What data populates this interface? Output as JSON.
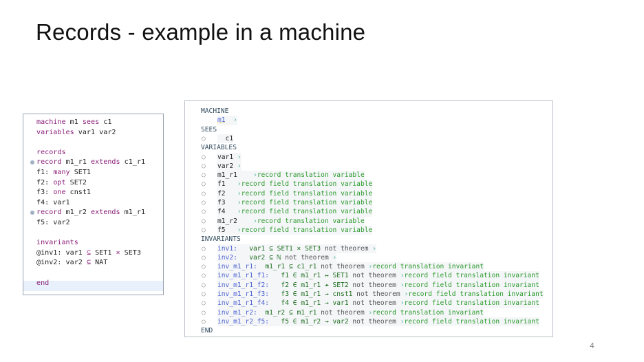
{
  "slide": {
    "title": "Records - example in a machine",
    "page_number": "4"
  },
  "editor": {
    "lines": [
      [
        {
          "t": "machine",
          "k": 1
        },
        {
          "t": " m1 "
        },
        {
          "t": "sees",
          "k": 1
        },
        {
          "t": " c1"
        }
      ],
      [
        {
          "t": "variables",
          "k": 1
        },
        {
          "t": " var1 var2"
        }
      ],
      [],
      [
        {
          "t": "records",
          "k": 1
        }
      ],
      [
        {
          "t": "record",
          "k": 1
        },
        {
          "t": " m1_r1 "
        },
        {
          "t": "extends",
          "k": 1
        },
        {
          "t": " c1_r1"
        }
      ],
      [
        {
          "t": "f1: "
        },
        {
          "t": "many",
          "k": 1
        },
        {
          "t": " SET1"
        }
      ],
      [
        {
          "t": "f2: "
        },
        {
          "t": "opt",
          "k": 1
        },
        {
          "t": " SET2"
        }
      ],
      [
        {
          "t": "f3: "
        },
        {
          "t": "one",
          "k": 1
        },
        {
          "t": " cnst1"
        }
      ],
      [
        {
          "t": "f4: var1"
        }
      ],
      [
        {
          "t": "record",
          "k": 1
        },
        {
          "t": " m1_r2 "
        },
        {
          "t": "extends",
          "k": 1
        },
        {
          "t": " m1_r1"
        }
      ],
      [
        {
          "t": "f5: var2"
        }
      ],
      [],
      [
        {
          "t": "invariants",
          "k": 1
        }
      ],
      [
        {
          "t": "@inv1: var1 "
        },
        {
          "t": "⊆",
          "k": 1
        },
        {
          "t": " SET1 "
        },
        {
          "t": "×",
          "k": 1
        },
        {
          "t": " SET3"
        }
      ],
      [
        {
          "t": "@inv2: var2 "
        },
        {
          "t": "⊆",
          "k": 1
        },
        {
          "t": " NAT"
        }
      ],
      [],
      [
        {
          "t": "end",
          "k": 1
        }
      ]
    ],
    "fold_lines": [
      4,
      9
    ],
    "highlight_line": 16
  },
  "translation": {
    "rows": [
      {
        "section": "MACHINE"
      },
      {
        "indent": 1,
        "segs": [
          {
            "t": "m1",
            "c": "label",
            "u": 1
          },
          {
            "t": "  ›",
            "c": "arrow"
          }
        ]
      },
      {
        "section": "SEES"
      },
      {
        "bullet": 1,
        "segs": [
          {
            "t": "  c1",
            "c": "dark"
          }
        ]
      },
      {
        "section": "VARIABLES"
      },
      {
        "bullet": 1,
        "segs": [
          {
            "t": "var1",
            "c": "dark"
          },
          {
            "t": " ›",
            "c": "arrow"
          }
        ]
      },
      {
        "bullet": 1,
        "segs": [
          {
            "t": "var2",
            "c": "dark"
          },
          {
            "t": " ›",
            "c": "arrow"
          }
        ]
      },
      {
        "bullet": 1,
        "segs": [
          {
            "t": "m1_r1    ",
            "c": "dark"
          },
          {
            "t": "›",
            "c": "arrow"
          },
          {
            "t": "record translation variable",
            "c": "cmt"
          }
        ]
      },
      {
        "bullet": 1,
        "segs": [
          {
            "t": "f1   ",
            "c": "dark"
          },
          {
            "t": "›",
            "c": "arrow"
          },
          {
            "t": "record field translation variable",
            "c": "cmt"
          }
        ]
      },
      {
        "bullet": 1,
        "segs": [
          {
            "t": "f2   ",
            "c": "dark"
          },
          {
            "t": "›",
            "c": "arrow"
          },
          {
            "t": "record field translation variable",
            "c": "cmt"
          }
        ]
      },
      {
        "bullet": 1,
        "segs": [
          {
            "t": "f3   ",
            "c": "dark"
          },
          {
            "t": "›",
            "c": "arrow"
          },
          {
            "t": "record field translation variable",
            "c": "cmt"
          }
        ]
      },
      {
        "bullet": 1,
        "segs": [
          {
            "t": "f4   ",
            "c": "dark"
          },
          {
            "t": "›",
            "c": "arrow"
          },
          {
            "t": "record field translation variable",
            "c": "cmt"
          }
        ]
      },
      {
        "bullet": 1,
        "segs": [
          {
            "t": "m1_r2    ",
            "c": "dark"
          },
          {
            "t": "›",
            "c": "arrow"
          },
          {
            "t": "record translation variable",
            "c": "cmt"
          }
        ]
      },
      {
        "bullet": 1,
        "segs": [
          {
            "t": "f5   ",
            "c": "dark"
          },
          {
            "t": "›",
            "c": "arrow"
          },
          {
            "t": "record field translation variable",
            "c": "cmt"
          }
        ]
      },
      {
        "section": "INVARIANTS"
      },
      {
        "bullet": 1,
        "segs": [
          {
            "t": "inv1:   ",
            "c": "label"
          },
          {
            "t": "var1 ⊆ SET1 × SET3",
            "c": "pred"
          },
          {
            "t": " not theorem ",
            "c": "gray"
          },
          {
            "t": "›",
            "c": "arrow"
          }
        ]
      },
      {
        "bullet": 1,
        "segs": [
          {
            "t": "inv2:   ",
            "c": "label"
          },
          {
            "t": "var2 ⊆ ℕ",
            "c": "pred"
          },
          {
            "t": " not theorem ",
            "c": "gray"
          },
          {
            "t": "›",
            "c": "arrow"
          }
        ]
      },
      {
        "bullet": 1,
        "segs": [
          {
            "t": "inv_m1_r1:  ",
            "c": "label"
          },
          {
            "t": "m1_r1 ⊆ c1_r1",
            "c": "pred"
          },
          {
            "t": " not theorem ",
            "c": "gray"
          },
          {
            "t": "›",
            "c": "arrow"
          },
          {
            "t": "record translation invariant",
            "c": "cmt"
          }
        ]
      },
      {
        "bullet": 1,
        "segs": [
          {
            "t": "inv_m1_r1_f1:   ",
            "c": "label"
          },
          {
            "t": "f1 ∈ m1_r1 ↔ SET1",
            "c": "pred"
          },
          {
            "t": " not theorem ",
            "c": "gray"
          },
          {
            "t": "›",
            "c": "arrow"
          },
          {
            "t": "record field translation invariant",
            "c": "cmt"
          }
        ]
      },
      {
        "bullet": 1,
        "segs": [
          {
            "t": "inv_m1_r1_f2:   ",
            "c": "label"
          },
          {
            "t": "f2 ∈ m1_r1 ⇸ SET2",
            "c": "pred"
          },
          {
            "t": " not theorem ",
            "c": "gray"
          },
          {
            "t": "›",
            "c": "arrow"
          },
          {
            "t": "record field translation invariant",
            "c": "cmt"
          }
        ]
      },
      {
        "bullet": 1,
        "segs": [
          {
            "t": "inv_m1_r1_f3:   ",
            "c": "label"
          },
          {
            "t": "f3 ∈ m1_r1 → cnst1",
            "c": "pred"
          },
          {
            "t": " not theorem ",
            "c": "gray"
          },
          {
            "t": "›",
            "c": "arrow"
          },
          {
            "t": "record field translation invariant",
            "c": "cmt"
          }
        ]
      },
      {
        "bullet": 1,
        "segs": [
          {
            "t": "inv_m1_r1_f4:   ",
            "c": "label"
          },
          {
            "t": "f4 ∈ m1_r1 → var1",
            "c": "pred"
          },
          {
            "t": " not theorem ",
            "c": "gray"
          },
          {
            "t": "›",
            "c": "arrow"
          },
          {
            "t": "record field translation invariant",
            "c": "cmt"
          }
        ]
      },
      {
        "bullet": 1,
        "segs": [
          {
            "t": "inv_m1_r2:  ",
            "c": "label"
          },
          {
            "t": "m1_r2 ⊆ m1_r1",
            "c": "pred"
          },
          {
            "t": " not theorem ",
            "c": "gray"
          },
          {
            "t": "›",
            "c": "arrow"
          },
          {
            "t": "record translation invariant",
            "c": "cmt"
          }
        ]
      },
      {
        "bullet": 1,
        "segs": [
          {
            "t": "inv_m1_r2_f5:   ",
            "c": "label"
          },
          {
            "t": "f5 ∈ m1_r2 → var2",
            "c": "pred"
          },
          {
            "t": " not theorem ",
            "c": "gray"
          },
          {
            "t": "›",
            "c": "arrow"
          },
          {
            "t": "record field translation invariant",
            "c": "cmt"
          }
        ]
      },
      {
        "section": "END"
      }
    ]
  },
  "colors": {
    "keyword": "#8a1f7a",
    "label": "#4b5fd0",
    "comment": "#2c9a2c",
    "section": "#2f4a5e"
  }
}
